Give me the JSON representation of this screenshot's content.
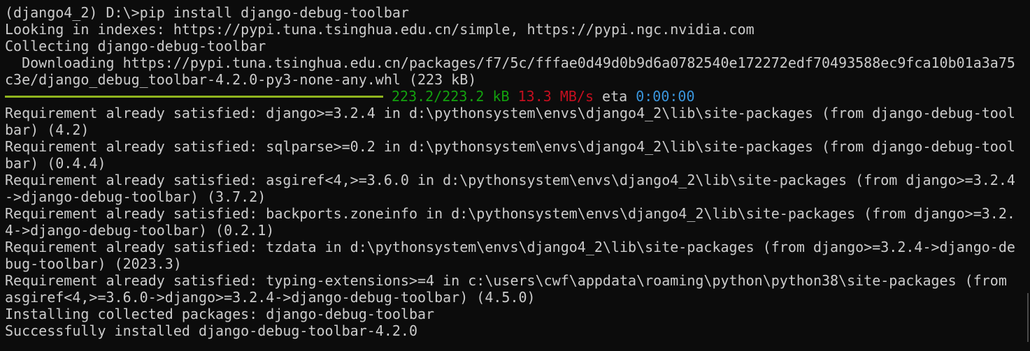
{
  "terminal": {
    "lines_before": [
      "(django4_2) D:\\>pip install django-debug-toolbar",
      "Looking in indexes: https://pypi.tuna.tsinghua.edu.cn/simple, https://pypi.ngc.nvidia.com",
      "Collecting django-debug-toolbar",
      "  Downloading https://pypi.tuna.tsinghua.edu.cn/packages/f7/5c/fffae0d49d0b9d6a0782540e172272edf70493588ec9fca10b01a3a75",
      "c3e/django_debug_toolbar-4.2.0-py3-none-any.whl (223 kB)"
    ],
    "progress": {
      "fraction": 1.0,
      "size": "223.2/223.2 kB",
      "speed": "13.3 MB/s",
      "eta_label": "eta",
      "eta_value": "0:00:00",
      "colors": {
        "bar": "#8fb31e",
        "size": "#13a10e",
        "speed": "#c50f1f",
        "eta_value": "#3a96dd"
      }
    },
    "lines_after": [
      "Requirement already satisfied: django>=3.2.4 in d:\\pythonsystem\\envs\\django4_2\\lib\\site-packages (from django-debug-tool",
      "bar) (4.2)",
      "Requirement already satisfied: sqlparse>=0.2 in d:\\pythonsystem\\envs\\django4_2\\lib\\site-packages (from django-debug-tool",
      "bar) (0.4.4)",
      "Requirement already satisfied: asgiref<4,>=3.6.0 in d:\\pythonsystem\\envs\\django4_2\\lib\\site-packages (from django>=3.2.4",
      "->django-debug-toolbar) (3.7.2)",
      "Requirement already satisfied: backports.zoneinfo in d:\\pythonsystem\\envs\\django4_2\\lib\\site-packages (from django>=3.2.",
      "4->django-debug-toolbar) (0.2.1)",
      "Requirement already satisfied: tzdata in d:\\pythonsystem\\envs\\django4_2\\lib\\site-packages (from django>=3.2.4->django-de",
      "bug-toolbar) (2023.3)",
      "Requirement already satisfied: typing-extensions>=4 in c:\\users\\cwf\\appdata\\roaming\\python\\python38\\site-packages (from",
      "asgiref<4,>=3.6.0->django>=3.2.4->django-debug-toolbar) (4.5.0)",
      "Installing collected packages: django-debug-toolbar",
      "Successfully installed django-debug-toolbar-4.2.0"
    ]
  },
  "colors": {
    "background": "#0c0c0c",
    "text": "#cccccc"
  }
}
